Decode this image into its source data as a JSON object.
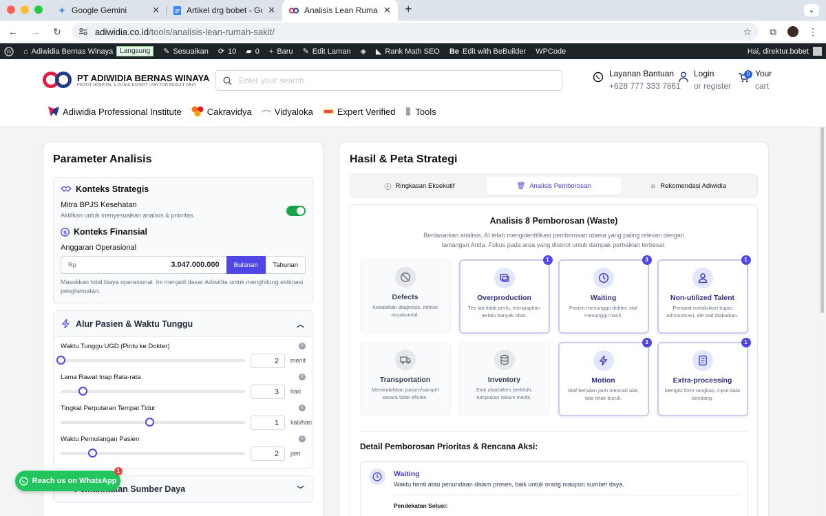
{
  "browser": {
    "tabs": [
      {
        "title": "Google Gemini"
      },
      {
        "title": "Artikel drg bobet - Google Do"
      },
      {
        "title": "Analisis Lean Rumah Sakit - A"
      }
    ],
    "url_host": "adiwidia.co.id",
    "url_path": "/tools/analisis-lean-rumah-sakit/"
  },
  "wpbar": {
    "site": "Adiwidia Bernas Winaya",
    "live": "Langsung",
    "customize": "Sesuaikan",
    "updates": "10",
    "comments": "0",
    "new": "Baru",
    "edit": "Edit Laman",
    "rankmath": "Rank Math SEO",
    "bebuilder": "Edit with BeBuilder",
    "wpcode": "WPCode",
    "greeting": "Hai, direktur.bobet"
  },
  "header": {
    "brand": "PT ADIWIDIA BERNAS WINAYA",
    "tagline": "PROFIT HOSPITAL & CLINIC EXPERT | PAY FOR RESULT ONLY",
    "search_placeholder": "Enter your search",
    "help_label": "Layanan Bantuan",
    "help_phone": "+628 777 333 7861",
    "login_label": "Login",
    "register_label": "or register",
    "cart_label": "Your",
    "cart_sub": "cart",
    "cart_count": "0",
    "menu": [
      {
        "label": "Adiwidia Professional Institute"
      },
      {
        "label": "Cakravidya"
      },
      {
        "label": "Vidyaloka"
      },
      {
        "label": "Expert Verified"
      },
      {
        "label": "Tools"
      }
    ]
  },
  "left": {
    "title": "Parameter Analisis",
    "strategic_title": "Konteks Strategis",
    "bpjs_label": "Mitra BPJS Kesehatan",
    "bpjs_sub": "Aktifkan untuk menyesuaikan analisis & prioritas.",
    "bpjs_on": true,
    "finance_title": "Konteks Finansial",
    "budget_label": "Anggaran Operasional",
    "currency": "Rp",
    "budget_value": "3.047.000.000",
    "period_monthly": "Bulanan",
    "period_yearly": "Tahunan",
    "budget_note": "Masukkan total biaya operasional. Ini menjadi dasar Adiwidia untuk menghitung estimasi penghematan.",
    "flow_title": "Alur Pasien & Waktu Tunggu",
    "sliders": [
      {
        "label": "Waktu Tunggu UGD (Pintu ke Dokter)",
        "value": "2",
        "unit": "menit",
        "fraction": 0.0
      },
      {
        "label": "Lama Rawat Inap Rata-rata",
        "value": "3",
        "unit": "hari",
        "fraction": 0.12
      },
      {
        "label": "Tingkat Perputaran Tempat Tidur",
        "value": "1",
        "unit": "kali/hari",
        "fraction": 0.48
      },
      {
        "label": "Waktu Pemulangan Pasien",
        "value": "2",
        "unit": "jam",
        "fraction": 0.17
      }
    ],
    "resource_title": "Pemanfaatan Sumber Daya"
  },
  "whatsapp": {
    "label": "Reach us on WhatsApp",
    "badge": "1"
  },
  "right": {
    "title": "Hasil & Peta Strategi",
    "tabs": [
      {
        "label": "Ringkasan Eksekutif"
      },
      {
        "label": "Analisis Pemborosan"
      },
      {
        "label": "Rekomendasi Adiwidia"
      }
    ],
    "waste_title": "Analisis 8 Pemborosan (Waste)",
    "waste_desc": "Berdasarkan analisis, AI telah mengidentifikasi pemborosan utama yang paling relevan dengan tantangan Anda. Fokus pada area yang disorot untuk dampak perbaikan terbesar.",
    "wastes": [
      {
        "name": "Defects",
        "desc": "Kesalahan diagnosis, infeksi nosokomial.",
        "count": "",
        "hot": false,
        "icon": "ban-icon"
      },
      {
        "name": "Overproduction",
        "desc": "Tes lab tidak perlu, menyiapkan terlalu banyak obat.",
        "count": "1",
        "hot": true,
        "icon": "copy-icon"
      },
      {
        "name": "Waiting",
        "desc": "Pasien menunggu dokter, staf menunggu hasil.",
        "count": "3",
        "hot": true,
        "icon": "clock-icon"
      },
      {
        "name": "Non-utilized Talent",
        "desc": "Perawat melakukan tugas administrasi, ide staf diabaikan.",
        "count": "1",
        "hot": true,
        "icon": "user-icon"
      },
      {
        "name": "Transportation",
        "desc": "Memindahkan pasien/sampel secara tidak efisien.",
        "count": "",
        "hot": false,
        "icon": "truck-icon"
      },
      {
        "name": "Inventory",
        "desc": "Stok obat/alkes berlebih, tumpukan rekam medis.",
        "count": "",
        "hot": false,
        "icon": "database-icon"
      },
      {
        "name": "Motion",
        "desc": "Staf berjalan jauh mencari alat, tata letak buruk.",
        "count": "3",
        "hot": true,
        "icon": "bolt-icon"
      },
      {
        "name": "Extra-processing",
        "desc": "Mengisi form rangkap, input data berulang.",
        "count": "1",
        "hot": true,
        "icon": "form-icon"
      }
    ],
    "detail_title": "Detail Pemborosan Prioritas & Rencana Aksi:",
    "detail": {
      "name": "Waiting",
      "desc": "Waktu henti atau penundaan dalam proses, baik untuk orang maupun sumber daya.",
      "solution_label": "Pendekatan Solusi:"
    }
  }
}
